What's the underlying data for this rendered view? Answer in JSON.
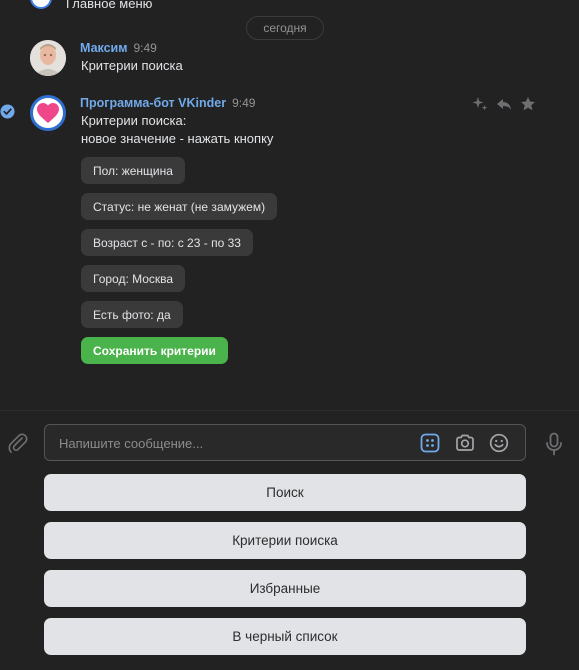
{
  "previous_message": {
    "text": "Главное меню"
  },
  "date_divider": "сегодня",
  "messages": [
    {
      "author": "Максим",
      "time": "9:49",
      "lines": [
        "Критерии поиска"
      ]
    },
    {
      "author": "Программа-бот VKinder",
      "time": "9:49",
      "lines": [
        "Критерии поиска:",
        "новое значение - нажать кнопку"
      ]
    }
  ],
  "inline_keyboard": [
    {
      "label": "Пол: женщина"
    },
    {
      "label": "Статус: не женат (не замужем)"
    },
    {
      "label": "Возраст с - по: с 23 - по 33"
    },
    {
      "label": "Город: Москва"
    },
    {
      "label": "Есть фото: да"
    },
    {
      "label": "Сохранить критерии",
      "color": "#4bb34b"
    }
  ],
  "composer": {
    "placeholder": "Напишите сообщение..."
  },
  "bot_keyboard": [
    {
      "label": "Поиск"
    },
    {
      "label": "Критерии поиска"
    },
    {
      "label": "Избранные"
    },
    {
      "label": "В черный список"
    }
  ],
  "colors": {
    "accent": "#71aaeb",
    "positive": "#4bb34b",
    "background": "#222222"
  },
  "icons": [
    "attach-icon",
    "keyboard-icon",
    "camera-icon",
    "smile-icon",
    "microphone-icon",
    "read-check-icon",
    "sparkle-icon",
    "reply-icon",
    "star-icon",
    "heart-logo-icon"
  ]
}
